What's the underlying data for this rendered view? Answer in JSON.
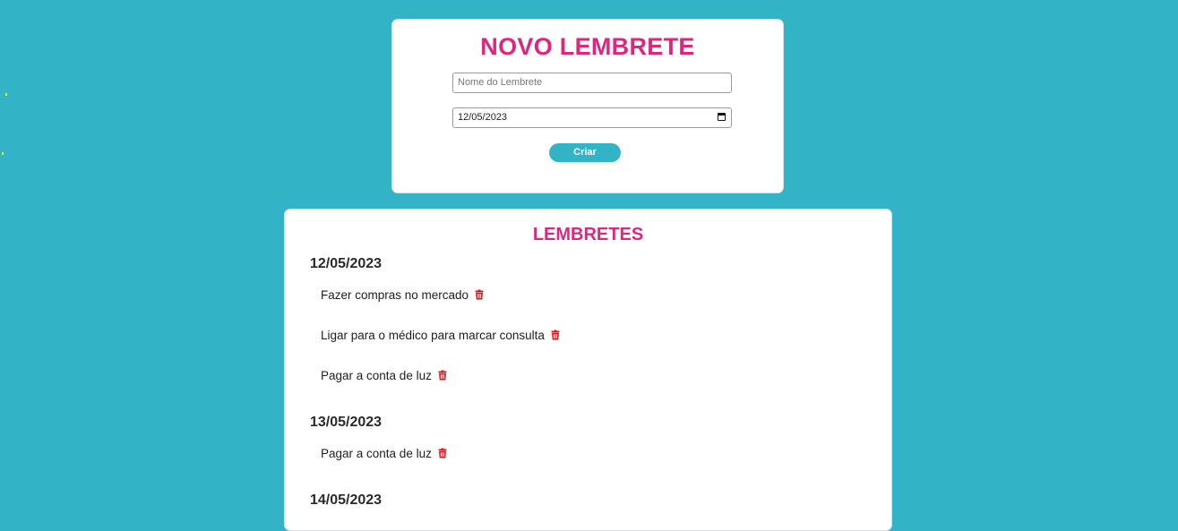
{
  "new_reminder": {
    "title": "NOVO LEMBRETE",
    "name_placeholder": "Nome do Lembrete",
    "date_value": "12/05/2023",
    "create_label": "Criar"
  },
  "reminders": {
    "title": "LEMBRETES",
    "groups": [
      {
        "date": "12/05/2023",
        "items": [
          "Fazer compras no mercado",
          "Ligar para o médico para marcar consulta",
          "Pagar a conta de luz"
        ]
      },
      {
        "date": "13/05/2023",
        "items": [
          "Pagar a conta de luz"
        ]
      },
      {
        "date": "14/05/2023",
        "items": []
      }
    ]
  },
  "colors": {
    "background": "#33b4c6",
    "accent": "#e0257f",
    "delete": "#d61a1a"
  },
  "icons": {
    "delete": "trash-icon",
    "date_picker": "calendar-icon"
  }
}
